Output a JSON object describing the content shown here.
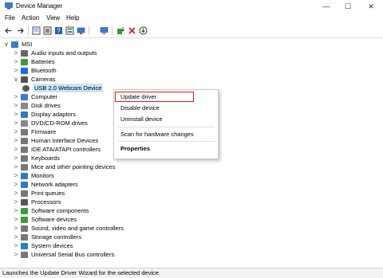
{
  "window": {
    "title": "Device Manager",
    "controls": [
      "—",
      "☐",
      "✕"
    ]
  },
  "menu": [
    "File",
    "Action",
    "View",
    "Help"
  ],
  "tree": [
    {
      "label": "MSI",
      "level": 0,
      "chevron": "∨",
      "color": "#3a7bd5"
    },
    {
      "label": "Audio inputs and outputs",
      "level": 1,
      "chevron": ">",
      "color": "#666"
    },
    {
      "label": "Batteries",
      "level": 1,
      "chevron": ">",
      "color": "#3c9a3c"
    },
    {
      "label": "Bluetooth",
      "level": 1,
      "chevron": ">",
      "color": "#1e6fd9"
    },
    {
      "label": "Cameras",
      "level": 1,
      "chevron": "∨",
      "color": "#555"
    },
    {
      "label": "USB 2.0 Webcam Device",
      "level": 2,
      "chevron": "",
      "color": "#555",
      "selected": true
    },
    {
      "label": "Computer",
      "level": 1,
      "chevron": ">",
      "color": "#3a7bd5"
    },
    {
      "label": "Disk drives",
      "level": 1,
      "chevron": ">",
      "color": "#888"
    },
    {
      "label": "Display adaptors",
      "level": 1,
      "chevron": ">",
      "color": "#2e7bbf"
    },
    {
      "label": "DVD/CD-ROM drives",
      "level": 1,
      "chevron": ">",
      "color": "#888"
    },
    {
      "label": "Firmware",
      "level": 1,
      "chevron": ">",
      "color": "#777"
    },
    {
      "label": "Human Interface Devices",
      "level": 1,
      "chevron": ">",
      "color": "#777"
    },
    {
      "label": "IDE ATA/ATAPI controllers",
      "level": 1,
      "chevron": ">",
      "color": "#777"
    },
    {
      "label": "Keyboards",
      "level": 1,
      "chevron": ">",
      "color": "#777"
    },
    {
      "label": "Mice and other pointing devices",
      "level": 1,
      "chevron": ">",
      "color": "#777"
    },
    {
      "label": "Monitors",
      "level": 1,
      "chevron": ">",
      "color": "#2e7bbf"
    },
    {
      "label": "Network adapters",
      "level": 1,
      "chevron": ">",
      "color": "#2e7bbf"
    },
    {
      "label": "Print queues",
      "level": 1,
      "chevron": ">",
      "color": "#777"
    },
    {
      "label": "Processors",
      "level": 1,
      "chevron": ">",
      "color": "#555"
    },
    {
      "label": "Software components",
      "level": 1,
      "chevron": ">",
      "color": "#3c9a3c"
    },
    {
      "label": "Software devices",
      "level": 1,
      "chevron": ">",
      "color": "#3c9a3c"
    },
    {
      "label": "Sound, video and game controllers",
      "level": 1,
      "chevron": ">",
      "color": "#777"
    },
    {
      "label": "Storage controllers",
      "level": 1,
      "chevron": ">",
      "color": "#777"
    },
    {
      "label": "System devices",
      "level": 1,
      "chevron": ">",
      "color": "#2e7bbf"
    },
    {
      "label": "Universal Serial Bus controllers",
      "level": 1,
      "chevron": ">",
      "color": "#777"
    }
  ],
  "context_menu": {
    "items": [
      "Update driver",
      "Disable device",
      "Uninstall device",
      "Scan for hardware changes",
      "Properties"
    ],
    "highlighted": "Update driver"
  },
  "status": "Launches the Update Driver Wizard for the selected device.",
  "accent": "#d71c1c"
}
